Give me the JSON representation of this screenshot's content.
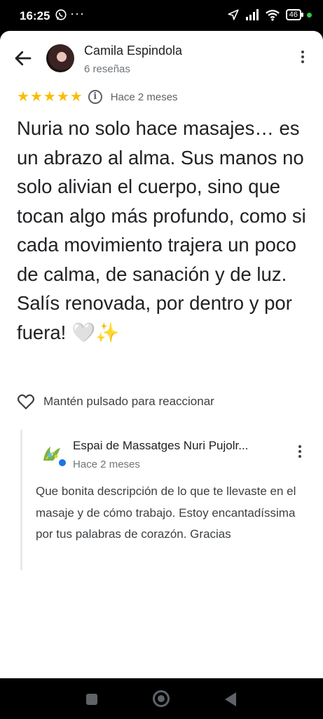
{
  "status_bar": {
    "time": "16:25",
    "overflow": "···",
    "battery": "46",
    "icons": [
      "whatsapp-icon",
      "location-arrow-icon",
      "signal-icon",
      "wifi-icon",
      "battery-icon"
    ]
  },
  "review": {
    "author": "Camila Espindola",
    "author_reviews": "6 reseñas",
    "rating": 5,
    "stars": [
      "★",
      "★",
      "★",
      "★",
      "★"
    ],
    "info_glyph": "i",
    "date": "Hace 2 meses",
    "text": "Nuria no solo hace masajes… es un abrazo al alma. Sus manos no solo alivian el cuerpo, sino que tocan algo más profundo, como si cada movimiento trajera un poco de calma, de sanación y de luz. Salís renovada, por dentro y por fuera! 🤍✨",
    "react_label": "Mantén pulsado para reaccionar"
  },
  "reply": {
    "owner_name": "Espai de Massatges Nuri Pujolr...",
    "date": "Hace 2 meses",
    "text": "Que bonita descripción de lo que te llevaste en el masaje y de cómo trabajo. Estoy encantadíssima por tus palabras de corazón. Gracias"
  },
  "colors": {
    "star": "#fbbc04",
    "verified": "#1a73e8",
    "text_primary": "#202124",
    "text_secondary": "#70757a"
  }
}
